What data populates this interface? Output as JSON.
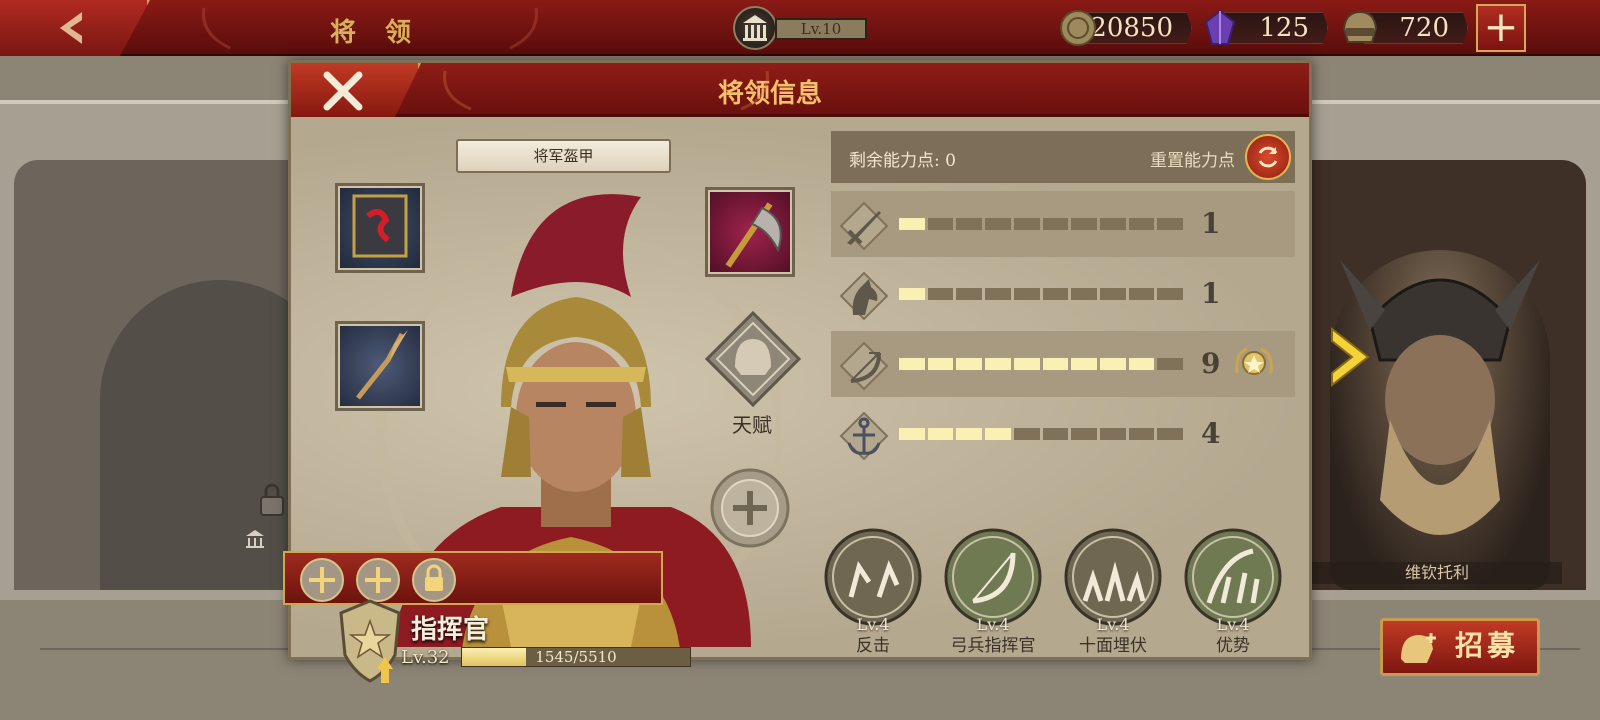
{
  "topbar": {
    "title": "将 领",
    "level": "Lv.10",
    "resources": [
      {
        "name": "coin",
        "value": "20850",
        "icon": "coin-icon"
      },
      {
        "name": "gem",
        "value": "125",
        "icon": "gem-icon"
      },
      {
        "name": "spqr",
        "value": "720",
        "icon": "spqr-helmet-icon"
      }
    ]
  },
  "modal": {
    "title": "将领信息",
    "armor_label": "将军盔甲",
    "talent_label": "天赋",
    "hero": {
      "rank": "指挥官",
      "level": "Lv.32",
      "xp_text": "1545/5510",
      "xp_fraction": 0.28
    },
    "stats": {
      "points_label": "剩余能力点: 0",
      "reset_label": "重置能力点",
      "rows": [
        {
          "icon": "sword-icon",
          "value": "1",
          "level": 1
        },
        {
          "icon": "horse-icon",
          "value": "1",
          "level": 1
        },
        {
          "icon": "bow-icon",
          "value": "9",
          "level": 9
        },
        {
          "icon": "anchor-icon",
          "value": "4",
          "level": 4
        }
      ]
    },
    "skills": [
      {
        "level": "Lv.4",
        "name": "反击"
      },
      {
        "level": "Lv.4",
        "name": "弓兵指挥官"
      },
      {
        "level": "Lv.4",
        "name": "十面埋伏"
      },
      {
        "level": "Lv.4",
        "name": "优势"
      }
    ]
  },
  "side": {
    "right_name": "维钦托利",
    "recruit_label": "招募"
  },
  "colors": {
    "accent_red": "#8f1d18",
    "gold": "#d4a24a",
    "bar_on": "#fbf0b4"
  }
}
